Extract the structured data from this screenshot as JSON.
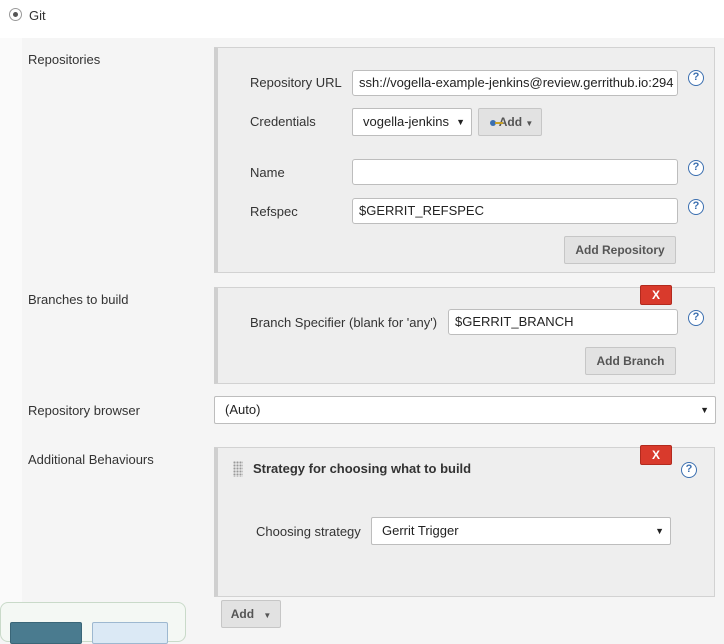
{
  "scm": {
    "label": "Git"
  },
  "repositories": {
    "section_label": "Repositories",
    "url_label": "Repository URL",
    "url_value": "ssh://vogella-example-jenkins@review.gerrithub.io:294",
    "credentials_label": "Credentials",
    "credentials_value": "vogella-jenkins",
    "add_credentials_label": "Add",
    "name_label": "Name",
    "name_value": "",
    "refspec_label": "Refspec",
    "refspec_value": "$GERRIT_REFSPEC",
    "add_repository_label": "Add Repository"
  },
  "branches": {
    "section_label": "Branches to build",
    "delete_label": "X",
    "specifier_label": "Branch Specifier (blank for 'any')",
    "specifier_value": "$GERRIT_BRANCH",
    "add_branch_label": "Add Branch"
  },
  "browser": {
    "section_label": "Repository browser",
    "selected": "(Auto)"
  },
  "behaviours": {
    "section_label": "Additional Behaviours",
    "delete_label": "X",
    "strategy_title": "Strategy for choosing what to build",
    "choosing_label": "Choosing strategy",
    "choosing_value": "Gerrit Trigger",
    "add_label": "Add"
  },
  "help_glyph": "?",
  "colors": {
    "delete_red": "#d93a2c",
    "help_blue": "#3b6fb0",
    "footer_dark": "#4a7b8f",
    "footer_light": "#dbe9f5"
  }
}
